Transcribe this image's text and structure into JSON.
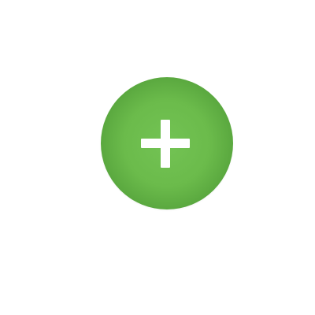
{
  "add_button": {
    "icon": "plus-icon",
    "colors": {
      "fill": "#6BBB4B",
      "fill_edge": "#5AA83F",
      "fill_highlight": "#73C354",
      "plus": "#FFFFFF"
    }
  }
}
